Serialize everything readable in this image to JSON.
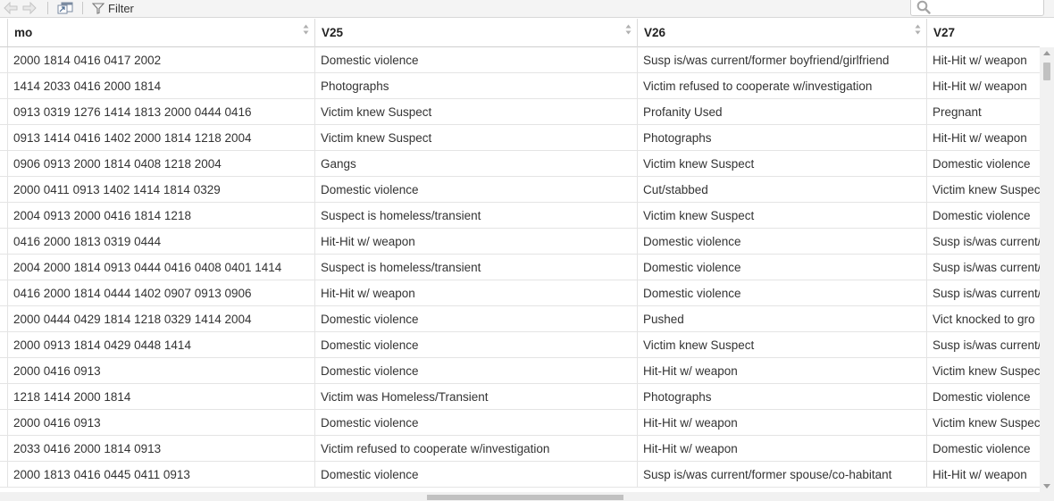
{
  "toolbar": {
    "filter_label": "Filter",
    "search_placeholder": ""
  },
  "table": {
    "columns": [
      "mo",
      "V25",
      "V26",
      "V27"
    ],
    "rows": [
      [
        "2000 1814 0416 0417 2002",
        "Domestic violence",
        "Susp is/was current/former boyfriend/girlfriend",
        "Hit-Hit w/ weapon"
      ],
      [
        "1414 2033 0416 2000 1814",
        "Photographs",
        "Victim refused to cooperate w/investigation",
        "Hit-Hit w/ weapon"
      ],
      [
        "0913 0319 1276 1414 1813 2000 0444 0416",
        "Victim knew Suspect",
        "Profanity Used",
        "Pregnant"
      ],
      [
        "0913 1414 0416 1402 2000 1814 1218 2004",
        "Victim knew Suspect",
        "Photographs",
        "Hit-Hit w/ weapon"
      ],
      [
        "0906 0913 2000 1814 0408 1218 2004",
        "Gangs",
        "Victim knew Suspect",
        "Domestic violence"
      ],
      [
        "2000 0411 0913 1402 1414 1814 0329",
        "Domestic violence",
        "Cut/stabbed",
        "Victim knew Suspec"
      ],
      [
        "2004 0913 2000 0416 1814 1218",
        "Suspect is homeless/transient",
        "Victim knew Suspect",
        "Domestic violence"
      ],
      [
        "0416 2000 1813 0319 0444",
        "Hit-Hit w/ weapon",
        "Domestic violence",
        "Susp is/was current/"
      ],
      [
        "2004 2000 1814 0913 0444 0416 0408 0401 1414",
        "Suspect is homeless/transient",
        "Domestic violence",
        "Susp is/was current/"
      ],
      [
        "0416 2000 1814 0444 1402 0907 0913 0906",
        "Hit-Hit w/ weapon",
        "Domestic violence",
        "Susp is/was current/"
      ],
      [
        "2000 0444 0429 1814 1218 0329 1414 2004",
        "Domestic violence",
        "Pushed",
        "Vict knocked to gro"
      ],
      [
        "2000 0913 1814 0429 0448 1414",
        "Domestic violence",
        "Victim knew Suspect",
        "Susp is/was current/"
      ],
      [
        "2000 0416 0913",
        "Domestic violence",
        "Hit-Hit w/ weapon",
        "Victim knew Suspec"
      ],
      [
        "1218 1414 2000 1814",
        "Victim was Homeless/Transient",
        "Photographs",
        "Domestic violence"
      ],
      [
        "2000 0416 0913",
        "Domestic violence",
        "Hit-Hit w/ weapon",
        "Victim knew Suspec"
      ],
      [
        "2033 0416 2000 1814 0913",
        "Victim refused to cooperate w/investigation",
        "Hit-Hit w/ weapon",
        "Domestic violence"
      ],
      [
        "2000 1813 0416 0445 0411 0913",
        "Domestic violence",
        "Susp is/was current/former spouse/co-habitant",
        "Hit-Hit w/ weapon"
      ]
    ]
  },
  "icons": {
    "back": "arrow-left-icon",
    "forward": "arrow-right-icon",
    "popout": "popout-window-icon",
    "filter": "funnel-icon",
    "search": "magnifier-icon",
    "sort": "sort-updown-icon"
  }
}
